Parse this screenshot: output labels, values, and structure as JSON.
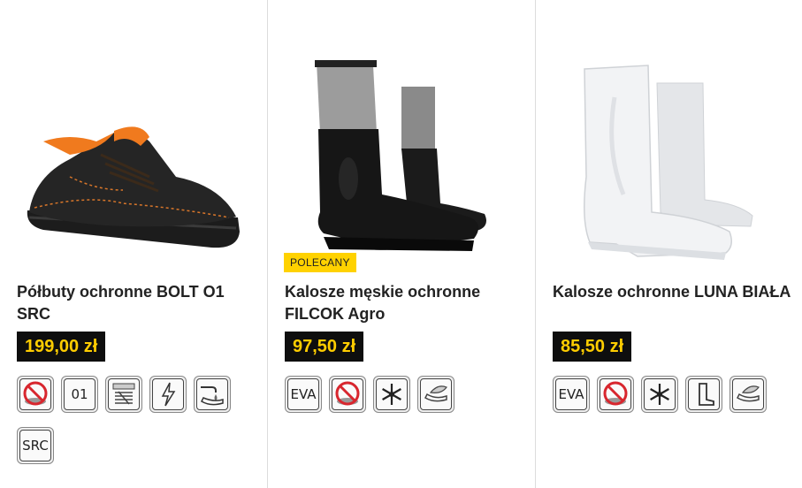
{
  "products": [
    {
      "title": "Półbuty ochronne BOLT O1 SRC",
      "price": "199,00 zł",
      "icons": [
        {
          "name": "no-metal-icon"
        },
        {
          "name": "o1-icon",
          "text": "01"
        },
        {
          "name": "antistatic-sole-icon"
        },
        {
          "name": "electric-icon"
        },
        {
          "name": "oil-resistant-icon"
        },
        {
          "name": "src-icon",
          "text": "SRC"
        }
      ]
    },
    {
      "title": "Kalosze męskie ochronne FILCOK Agro",
      "price": "97,50 zł",
      "badge": "POLECANY",
      "icons": [
        {
          "name": "eva-icon",
          "text": "EVA"
        },
        {
          "name": "no-metal-icon"
        },
        {
          "name": "snowflake-icon"
        },
        {
          "name": "leaf-sole-icon"
        }
      ]
    },
    {
      "title": "Kalosze ochronne LUNA BIAŁA",
      "price": "85,50 zł",
      "icons": [
        {
          "name": "eva-icon",
          "text": "EVA"
        },
        {
          "name": "no-metal-icon"
        },
        {
          "name": "snowflake-icon"
        },
        {
          "name": "boot-icon"
        },
        {
          "name": "leaf-sole-icon"
        }
      ]
    }
  ]
}
